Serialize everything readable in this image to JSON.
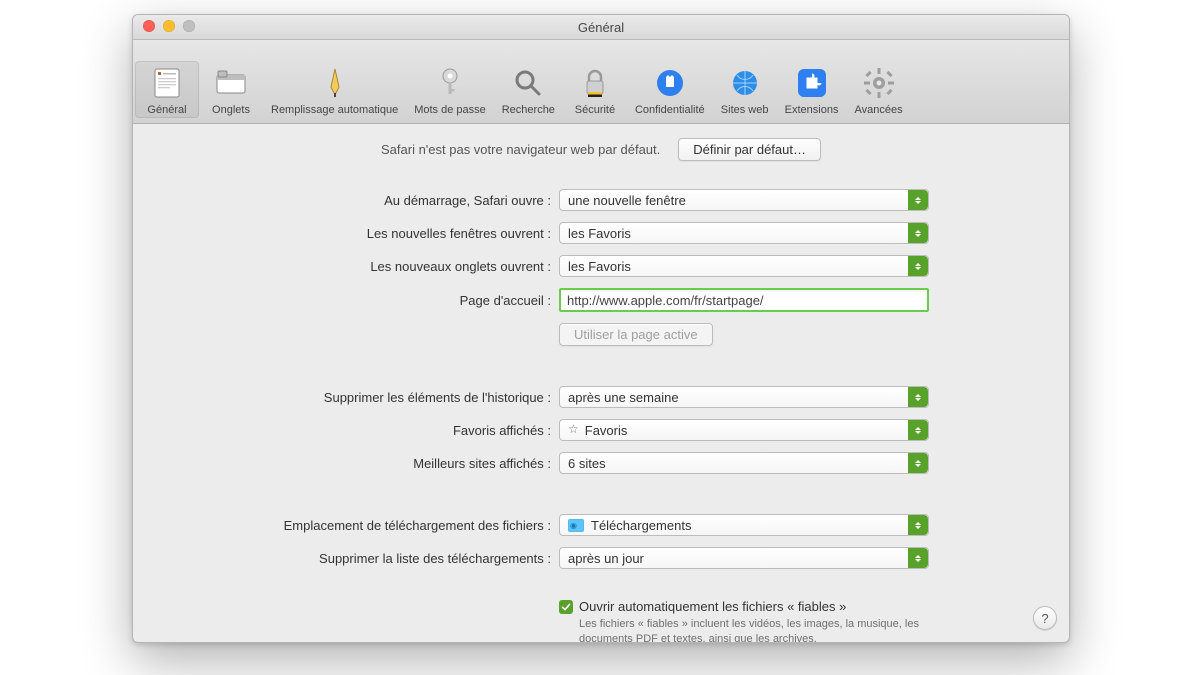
{
  "window": {
    "title": "Général"
  },
  "toolbar": {
    "items": [
      {
        "id": "general",
        "label": "Général"
      },
      {
        "id": "tabs",
        "label": "Onglets"
      },
      {
        "id": "autofill",
        "label": "Remplissage automatique"
      },
      {
        "id": "passwords",
        "label": "Mots de passe"
      },
      {
        "id": "search",
        "label": "Recherche"
      },
      {
        "id": "security",
        "label": "Sécurité"
      },
      {
        "id": "privacy",
        "label": "Confidentialité"
      },
      {
        "id": "websites",
        "label": "Sites web"
      },
      {
        "id": "extensions",
        "label": "Extensions"
      },
      {
        "id": "advanced",
        "label": "Avancées"
      }
    ],
    "selected_id": "general"
  },
  "header": {
    "not_default_text": "Safari n'est pas votre navigateur web par défaut.",
    "set_default_button": "Définir par défaut…"
  },
  "rows": {
    "on_launch": {
      "label": "Au démarrage, Safari ouvre :",
      "value": "une nouvelle fenêtre"
    },
    "new_windows": {
      "label": "Les nouvelles fenêtres ouvrent :",
      "value": "les Favoris"
    },
    "new_tabs": {
      "label": "Les nouveaux onglets ouvrent :",
      "value": "les Favoris"
    },
    "homepage": {
      "label": "Page d'accueil :",
      "value": "http://www.apple.com/fr/startpage/"
    },
    "use_current": {
      "button": "Utiliser la page active"
    },
    "remove_history": {
      "label": "Supprimer les éléments de l'historique :",
      "value": "après une semaine"
    },
    "favorites_shown": {
      "label": "Favoris affichés :",
      "value": "Favoris"
    },
    "top_sites": {
      "label": "Meilleurs sites affichés :",
      "value": "6 sites"
    },
    "download_loc": {
      "label": "Emplacement de téléchargement des fichiers :",
      "value": "Téléchargements"
    },
    "download_clear": {
      "label": "Supprimer la liste des téléchargements :",
      "value": "après un jour"
    },
    "safe_open": {
      "label": "Ouvrir automatiquement les fichiers « fiables »",
      "help": "Les fichiers « fiables » incluent les vidéos, les images, la musique, les documents PDF et textes, ainsi que les archives.",
      "checked": true
    }
  },
  "help_glyph": "?"
}
